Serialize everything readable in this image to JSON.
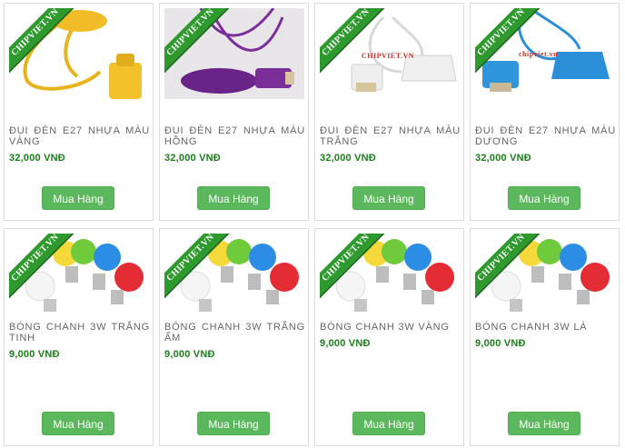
{
  "products": [
    {
      "name": "ĐUI ĐÈN E27 NHỰA MÀU VÀNG",
      "price": "32,000 VNĐ",
      "button": "Mua Hàng",
      "ribbon": "CHIPVIET.VN",
      "watermark": "",
      "icon": "yellow-lamp-holder-icon",
      "color": "#f3c12a"
    },
    {
      "name": "ĐUI ĐÈN E27 NHỰA MÀU HỒNG",
      "price": "32,000 VNĐ",
      "button": "Mua Hàng",
      "ribbon": "CHIPVIET.VN",
      "watermark": "",
      "icon": "purple-lamp-holder-icon",
      "color": "#7b2e9a"
    },
    {
      "name": "ĐUI ĐÈN E27 NHỰA MÀU TRẮNG",
      "price": "32,000 VNĐ",
      "button": "Mua Hàng",
      "ribbon": "CHIPVIET.VN",
      "watermark": "CHIPVIET.VN",
      "icon": "white-lamp-holder-icon",
      "color": "#eeeeee"
    },
    {
      "name": "ĐUI ĐÈN E27 NHỰA MÀU DƯƠNG",
      "price": "32,000 VNĐ",
      "button": "Mua Hàng",
      "ribbon": "CHIPVIET.VN",
      "watermark": "chipviet.vn",
      "icon": "blue-lamp-holder-icon",
      "color": "#2a8fd6"
    },
    {
      "name": "BÓNG CHANH 3W TRẮNG TINH",
      "price": "9,000 VNĐ",
      "button": "Mua Hàng",
      "ribbon": "CHIPVIET.VN",
      "watermark": "",
      "icon": "color-bulbs-icon",
      "color": "#ffffff"
    },
    {
      "name": "BÓNG CHANH 3W TRẮNG ẤM",
      "price": "9,000 VNĐ",
      "button": "Mua Hàng",
      "ribbon": "CHIPVIET.VN",
      "watermark": "",
      "icon": "color-bulbs-icon",
      "color": "#ffffff"
    },
    {
      "name": "BÓNG CHANH 3W VÀNG",
      "price": "9,000 VNĐ",
      "button": "Mua Hàng",
      "ribbon": "CHIPVIET.VN",
      "watermark": "",
      "icon": "color-bulbs-icon",
      "color": "#ffffff"
    },
    {
      "name": "BÓNG CHANH 3W LÁ",
      "price": "9,000 VNĐ",
      "button": "Mua Hàng",
      "ribbon": "CHIPVIET.VN",
      "watermark": "",
      "icon": "color-bulbs-icon",
      "color": "#ffffff"
    }
  ],
  "colors": {
    "accent": "#5cb85c",
    "price": "#1a7f1a",
    "ribbon": "#2e9a2e"
  }
}
